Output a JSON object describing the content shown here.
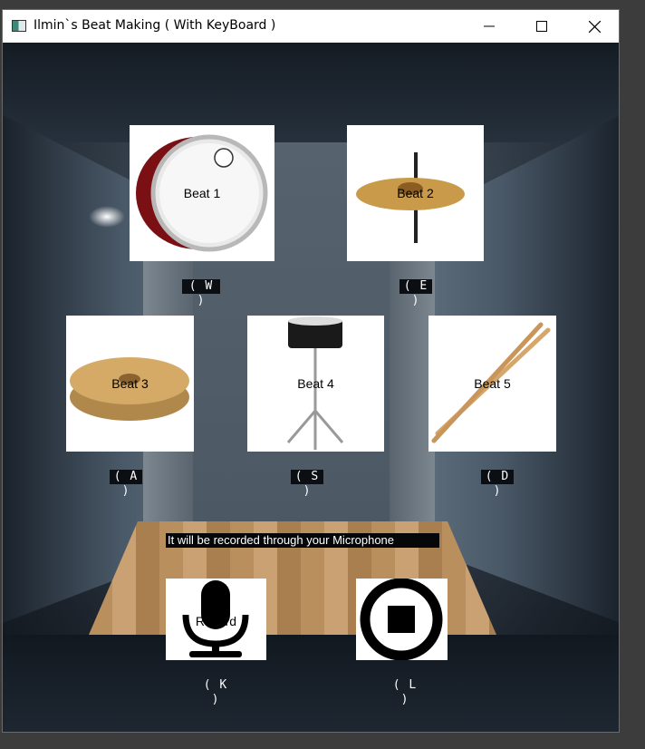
{
  "window": {
    "title": "Ilmin`s Beat Making ( With KeyBoard )"
  },
  "controls": {
    "minimize": "minimize",
    "maximize": "maximize",
    "close": "close"
  },
  "pads": [
    {
      "label": "Beat 1",
      "key": "( W )",
      "icon": "bass-drum-icon"
    },
    {
      "label": "Beat 2",
      "key": "( E )",
      "icon": "cymbal-icon"
    },
    {
      "label": "Beat 3",
      "key": "( A )",
      "icon": "hihat-icon"
    },
    {
      "label": "Beat 4",
      "key": "( S )",
      "icon": "snare-drum-icon"
    },
    {
      "label": "Beat 5",
      "key": "( D )",
      "icon": "drumsticks-icon"
    }
  ],
  "notice": "It will be recorded through your Microphone",
  "record": {
    "label": "Record",
    "key": "( K )",
    "icon": "microphone-icon"
  },
  "stop": {
    "key": "( L )",
    "icon": "stop-icon"
  },
  "colors": {
    "background": "#1d2530",
    "titlebar": "#ffffff",
    "key_bg": "#0b0f14"
  }
}
